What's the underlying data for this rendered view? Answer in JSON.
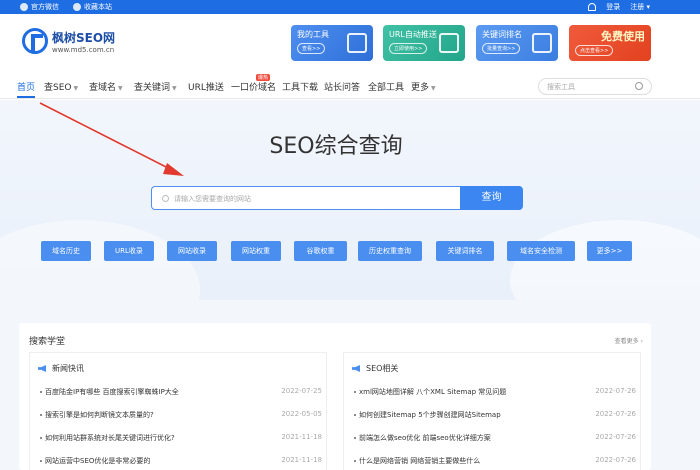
{
  "topbar": {
    "wechat_label": "官方微信",
    "favorite_label": "收藏本站",
    "login_label": "登录",
    "register_label": "注册"
  },
  "logo": {
    "name": "枫树SEO网",
    "url": "www.md5.com.cn"
  },
  "promos": [
    {
      "title": "我的工具",
      "button": "查看>>"
    },
    {
      "title": "URL自动推送",
      "button": "立即使用>>"
    },
    {
      "title": "关键词排名",
      "button": "批量查询>>"
    },
    {
      "title": "免费使用",
      "button": "点击查看>>"
    }
  ],
  "nav": {
    "items": [
      "首页",
      "查SEO",
      "查域名",
      "查关键词",
      "URL推送",
      "一口价域名",
      "工具下载",
      "站长问答",
      "全部工具",
      "更多"
    ],
    "badge": "爆热",
    "search_placeholder": "搜索工具"
  },
  "hero": {
    "title": "SEO综合查询",
    "search_placeholder": "请输入您需要查询的网站",
    "search_button": "查询",
    "quick_buttons": [
      "域名历史",
      "URL收录",
      "网站收录",
      "网站权重",
      "谷歌权重",
      "历史权重查询",
      "关键词排名",
      "域名安全检测",
      "更多>>"
    ]
  },
  "panel": {
    "title": "搜索学堂",
    "more": "查看更多",
    "left": {
      "heading": "新闻快讯",
      "rows": [
        {
          "text": "百度陆金IP有哪些 百度搜索引擎蜘蛛IP大全",
          "date": "2022-07-25"
        },
        {
          "text": "搜索引擎是如何判断镜文本质量的?",
          "date": "2022-05-05"
        },
        {
          "text": "如何利用站群系统对长尾关键词进行优化?",
          "date": "2021-11-18"
        },
        {
          "text": "网站运营中SEO优化是非常必要的",
          "date": "2021-11-18"
        }
      ]
    },
    "right": {
      "heading": "SEO相关",
      "rows": [
        {
          "text": "xml网站地图详解 八个XML Sitemap 常见问题",
          "date": "2022-07-26"
        },
        {
          "text": "如何创建Sitemap 5个步骤创建网站Sitemap",
          "date": "2022-07-26"
        },
        {
          "text": "前端怎么做seo优化 前端seo优化详细方案",
          "date": "2022-07-26"
        },
        {
          "text": "什么是网络营销 网络营销主要做些什么",
          "date": "2022-07-26"
        }
      ]
    }
  },
  "colors": {
    "brand": "#1e6de2",
    "button": "#4a8ef0",
    "arrow": "#e23a2e"
  }
}
